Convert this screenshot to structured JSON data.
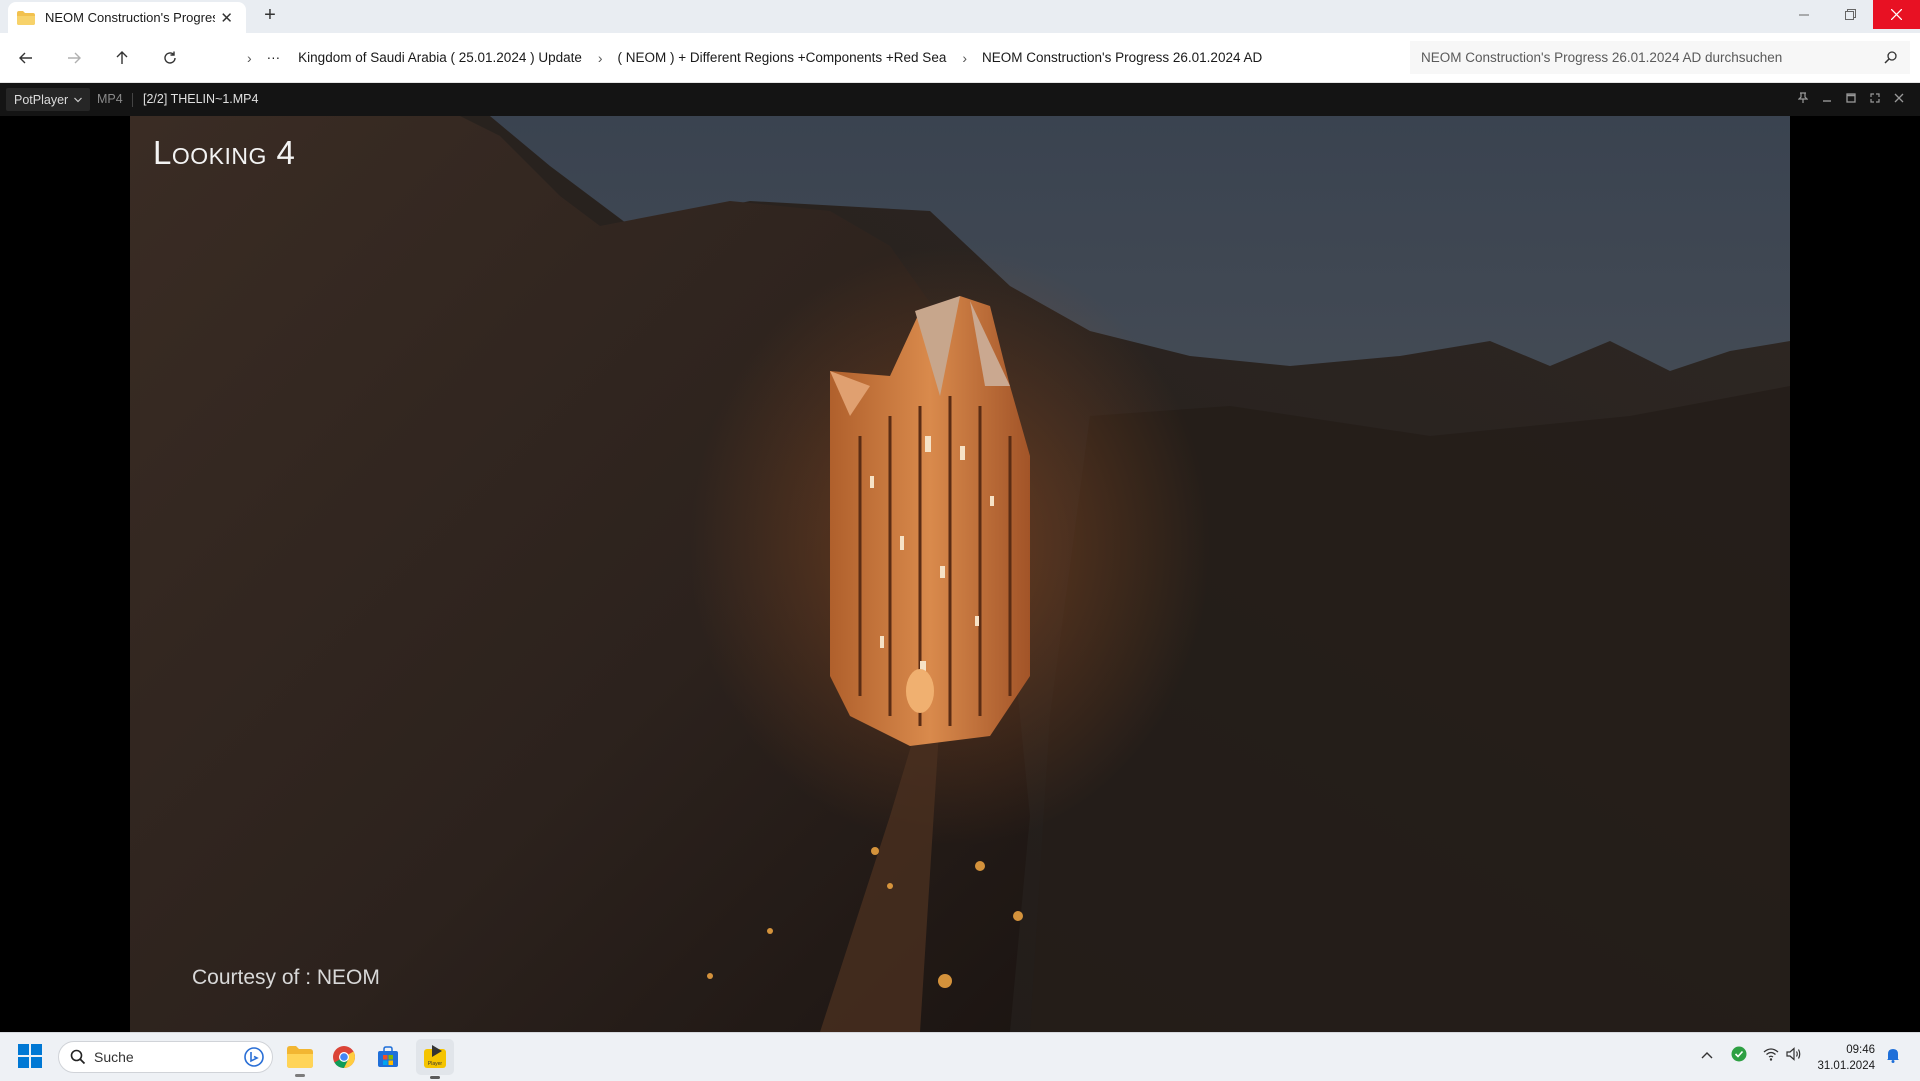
{
  "explorer": {
    "tab_title": "NEOM Construction's Progress",
    "new_tab": "+",
    "breadcrumbs": [
      "Kingdom of Saudi Arabia ( 25.01.2024 ) Update",
      "( NEOM ) + Different Regions +Components +Red Sea",
      "NEOM Construction's Progress 26.01.2024 AD"
    ],
    "more": "···",
    "search_placeholder": "NEOM Construction's Progress 26.01.2024 AD durchsuchen"
  },
  "player": {
    "menu_label": "PotPlayer",
    "format": "MP4",
    "file": "[2/2] THELIN~1.MP4",
    "overlay_title": "Looking 4",
    "overlay_credit": "Courtesy of : NEOM"
  },
  "taskbar": {
    "search_label": "Suche",
    "apps": [
      "file-explorer",
      "chrome",
      "microsoft-store",
      "potplayer"
    ],
    "time": "09:46",
    "date": "31.01.2024"
  },
  "colors": {
    "close_red": "#e81123",
    "taskbar_bg": "#eef1f5",
    "player_bg": "#141414",
    "windows_blue": "#0078d4"
  }
}
